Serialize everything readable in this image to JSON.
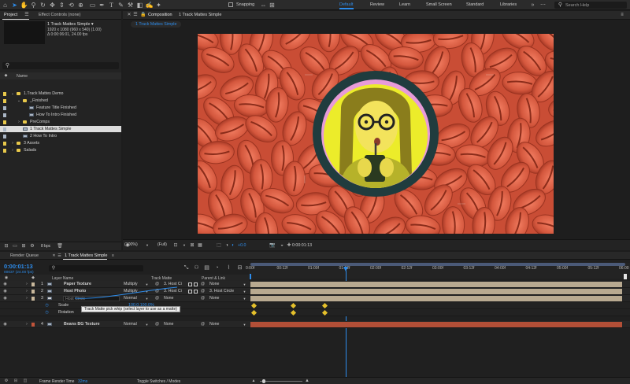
{
  "toolbar": {
    "snapping": "Snapping",
    "workspaces": [
      "Default",
      "Review",
      "Learn",
      "Small Screen",
      "Standard",
      "Libraries"
    ],
    "search_placeholder": "Search Help"
  },
  "project_panel": {
    "tabs": [
      "Project",
      "Effect Controls (none)"
    ],
    "selected_name": "1 Track Mattes Simple ▾",
    "selected_info1": "1920 x 1080  (960 x 540) (1.00)",
    "selected_info2": "Δ 0:00:06:01, 24.00 fps",
    "search_prompt": "⌕",
    "column_name": "Name",
    "items": [
      {
        "label": "1.Track Mattes Demo",
        "type": "folder",
        "depth": 0,
        "open": true
      },
      {
        "label": "_Finished",
        "type": "folder",
        "depth": 1,
        "open": true
      },
      {
        "label": "Feature Title Finished",
        "type": "comp",
        "depth": 2
      },
      {
        "label": "How To Intro Finished",
        "type": "comp",
        "depth": 2
      },
      {
        "label": "PreComps",
        "type": "folder",
        "depth": 1,
        "open": false
      },
      {
        "label": "1 Track Mattes Simple",
        "type": "comp",
        "depth": 1,
        "selected": true
      },
      {
        "label": "2 How To Intro",
        "type": "comp",
        "depth": 1
      },
      {
        "label": "3 Assets",
        "type": "folder",
        "depth": 0,
        "open": false
      },
      {
        "label": "Salads",
        "type": "folder",
        "depth": 0,
        "open": false
      }
    ],
    "bpc": "8 bpc"
  },
  "composition_panel": {
    "tab_label": "Composition",
    "tab_name": "1 Track Mattes Simple",
    "breadcrumb": "1 Track Mattes Simple",
    "zoom": "(100%)",
    "resolution": "(Full)",
    "exposure": "+0.0",
    "timecode": "0:00:01:13"
  },
  "timeline": {
    "tabs": [
      "Render Queue",
      "1 Track Mattes Simple"
    ],
    "current_time": "0:00:01:13",
    "frame_info": "00037 (24.00 fps)",
    "col_layer_name": "Layer Name",
    "col_track_matte": "Track Matte",
    "col_parent": "Parent & Link",
    "ruler": [
      "0:00f",
      "00:12f",
      "01:00f",
      "01:12f",
      "02:00f",
      "02:12f",
      "03:00f",
      "03:12f",
      "04:00f",
      "04:12f",
      "05:00f",
      "05:12f",
      "06:00"
    ],
    "layers": [
      {
        "num": "1",
        "name": "Paper Texture",
        "mode": "Multiply",
        "matte": "3. Host Ci",
        "parent": "None",
        "color": "#c9b89c"
      },
      {
        "num": "2",
        "name": "Host Photo",
        "mode": "Multiply",
        "matte": "3. Host Ci",
        "parent": "3. Host Circle",
        "color": "#c9b89c"
      },
      {
        "num": "3",
        "name": "Host Circle",
        "mode": "Normal",
        "matte": "None",
        "parent": "None",
        "color": "#c9b89c",
        "editing": true
      },
      {
        "num": "4",
        "name": "Beans BG Texture",
        "mode": "Normal",
        "matte": "None",
        "parent": "None",
        "color": "#c2543a"
      }
    ],
    "props": [
      {
        "name": "Scale",
        "value": "100.0,100.0%"
      },
      {
        "name": "Rotation",
        "value": ""
      }
    ],
    "tooltip": "Track Matte pick whip (select layer to use as a matte)",
    "footer_left": "Frame Render Time",
    "footer_ms": "32ms",
    "footer_toggle": "Toggle Switches / Modes",
    "accent": "#2d8ceb",
    "timecode_color": "#2d8ceb"
  }
}
